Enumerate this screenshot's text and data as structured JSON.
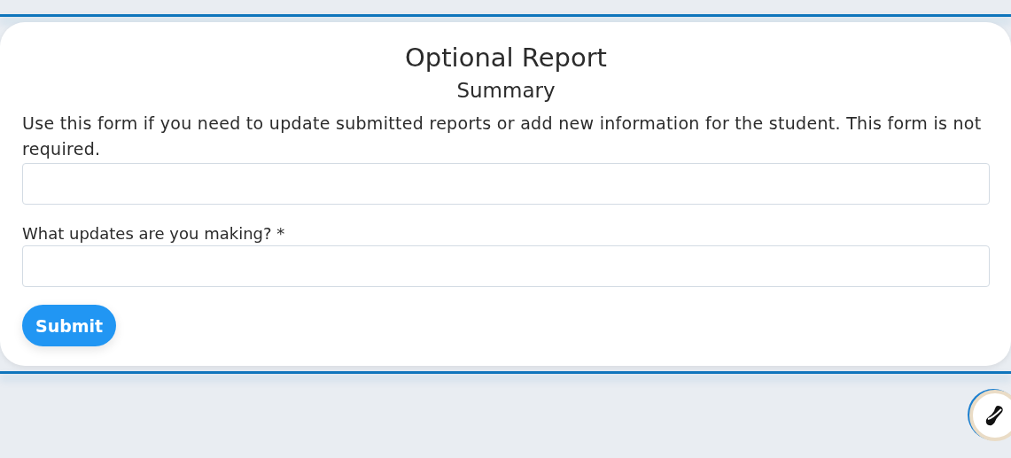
{
  "form": {
    "title": "Optional Report",
    "subtitle": "Summary",
    "description": "Use this form if you need to update submitted reports or add new information for the student. This form is not required.",
    "fields": [
      {
        "kind": "text"
      },
      {
        "kind": "text",
        "label": "What updates are you making? *"
      }
    ],
    "submit": "Submit"
  }
}
